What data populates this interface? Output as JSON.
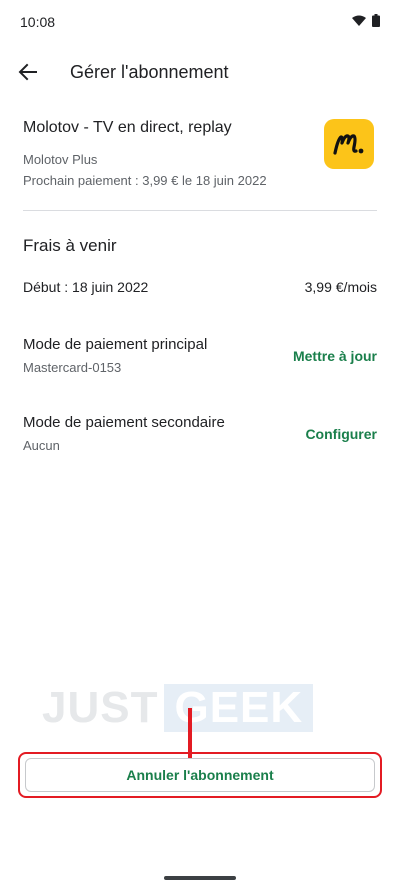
{
  "status_bar": {
    "time": "10:08",
    "icons": [
      "wifi-icon",
      "battery-icon"
    ]
  },
  "header": {
    "title": "Gérer l'abonnement",
    "back_icon": "arrow-back-icon"
  },
  "subscription": {
    "app_name": "Molotov - TV en direct, replay",
    "plan": "Molotov Plus",
    "next_payment": "Prochain paiement : 3,99 € le 18 juin 2022",
    "app_icon_letter": "m.",
    "app_icon_color": "#fcc419"
  },
  "upcoming": {
    "title": "Frais à venir",
    "start_label": "Début : 18 juin 2022",
    "price": "3,99 €/mois"
  },
  "primary_payment": {
    "label": "Mode de paiement principal",
    "value": "Mastercard-0153",
    "action": "Mettre à jour"
  },
  "secondary_payment": {
    "label": "Mode de paiement secondaire",
    "value": "Aucun",
    "action": "Configurer"
  },
  "watermark": {
    "part1": "JUST",
    "part2": "GEEK"
  },
  "cancel_button": {
    "label": "Annuler l'abonnement"
  },
  "colors": {
    "accent_green": "#1a7f4b",
    "highlight_red": "#e31b23"
  }
}
